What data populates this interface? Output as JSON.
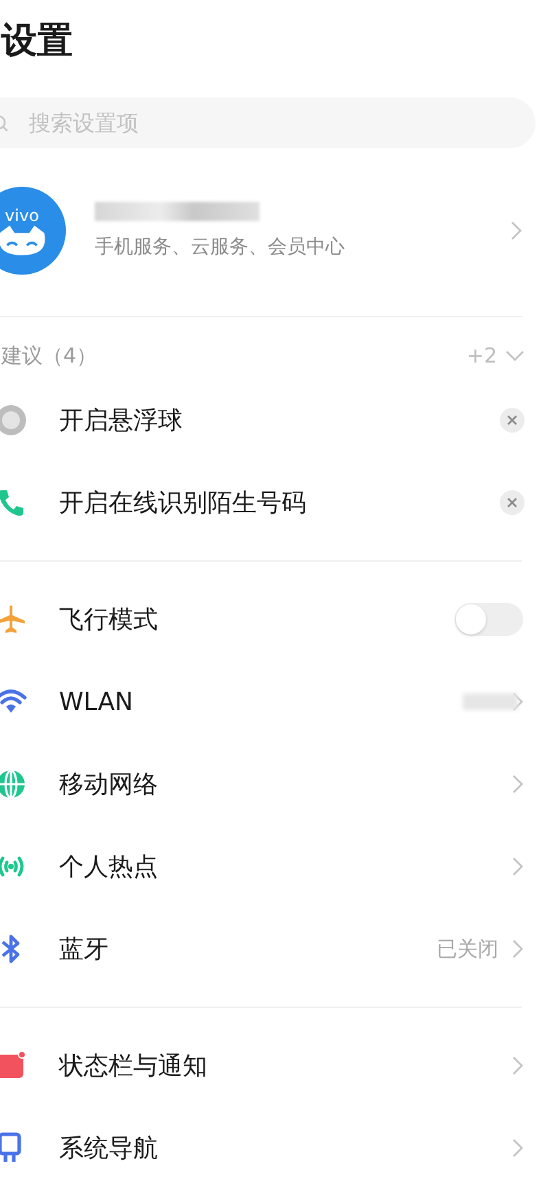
{
  "title": "设置",
  "search": {
    "placeholder": "搜索设置项"
  },
  "account": {
    "avatar_text": "vivo",
    "name_blurred": true,
    "subtitle": "手机服务、云服务、会员中心"
  },
  "suggestions": {
    "label": "建议（4）",
    "more": "+2",
    "items": [
      {
        "label": "开启悬浮球"
      },
      {
        "label": "开启在线识别陌生号码"
      }
    ]
  },
  "groups": [
    {
      "items": [
        {
          "kind": "toggle",
          "label": "飞行模式",
          "on": false
        },
        {
          "kind": "link",
          "label": "WLAN",
          "value_blurred": true
        },
        {
          "kind": "link",
          "label": "移动网络"
        },
        {
          "kind": "link",
          "label": "个人热点"
        },
        {
          "kind": "link",
          "label": "蓝牙",
          "value": "已关闭"
        }
      ]
    },
    {
      "items": [
        {
          "kind": "link",
          "label": "状态栏与通知"
        },
        {
          "kind": "link",
          "label": "系统导航"
        }
      ]
    }
  ]
}
